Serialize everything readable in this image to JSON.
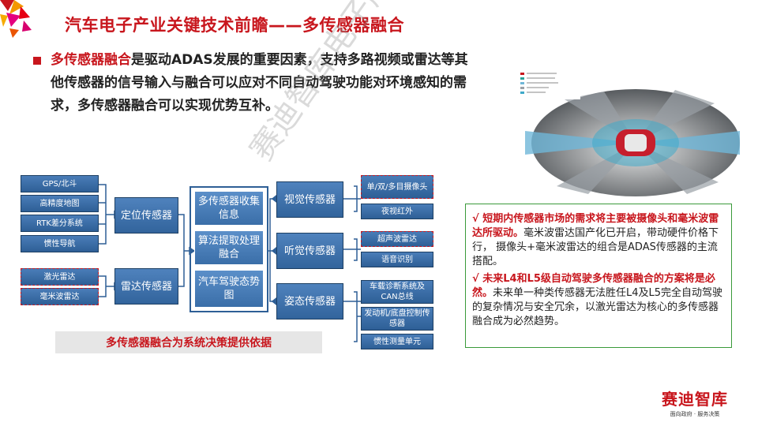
{
  "title": "汽车电子产业关键技术前瞻——多传感器融合",
  "intro": {
    "highlight": "多传感器融合",
    "text": "是驱动ADAS发展的重要因素，支持多路视频或雷达等其他传感器的信号输入与融合可以应对不同自动驾驶功能对环境感知的需求，多传感器融合可以实现优势互补。"
  },
  "diagram": {
    "left_items": [
      "GPS/北斗",
      "高精度地图",
      "RTK差分系统",
      "惯性导航",
      "激光雷达",
      "毫米波雷达"
    ],
    "mid_left": [
      "定位传感器",
      "雷达传感器"
    ],
    "center": [
      "多传感器收集信息",
      "算法提取处理融合",
      "汽车驾驶态势图"
    ],
    "mid_right": [
      "视觉传感器",
      "听觉传感器",
      "姿态传感器"
    ],
    "right_items": [
      "单/双/多目摄像头",
      "夜视红外",
      "超声波雷达",
      "语音识别",
      "车载诊断系统及CAN总线",
      "发动机/底盘控制传感器",
      "惯性测量单元"
    ],
    "caption": "多传感器融合为系统决策提供依据"
  },
  "notes": [
    {
      "mark": "√ ",
      "bold": "短期内传感器市场的需求将主要被摄像头和毫米波雷达所驱动。",
      "text": "毫米波雷达国产化已开启，带动硬件价格下行， 摄像头+毫米波雷达的组合是ADAS传感器的主流搭配。"
    },
    {
      "mark": "√ ",
      "bold": "未来L4和L5级自动驾驶多传感器融合的方案将是必然。",
      "text": "未来单一种类传感器无法胜任L4及L5完全自动驾驶的复杂情况与安全冗余，以激光雷达为核心的多传感器融合成为必然趋势。"
    }
  ],
  "watermark": "赛迪智库电子所",
  "brand": {
    "name": "赛迪智库",
    "slogan": "面向政府 · 服务决策"
  },
  "colors": {
    "accent": "#c8161d",
    "box_blue": "#3a6ea8",
    "note_border": "#3a9a3a"
  }
}
